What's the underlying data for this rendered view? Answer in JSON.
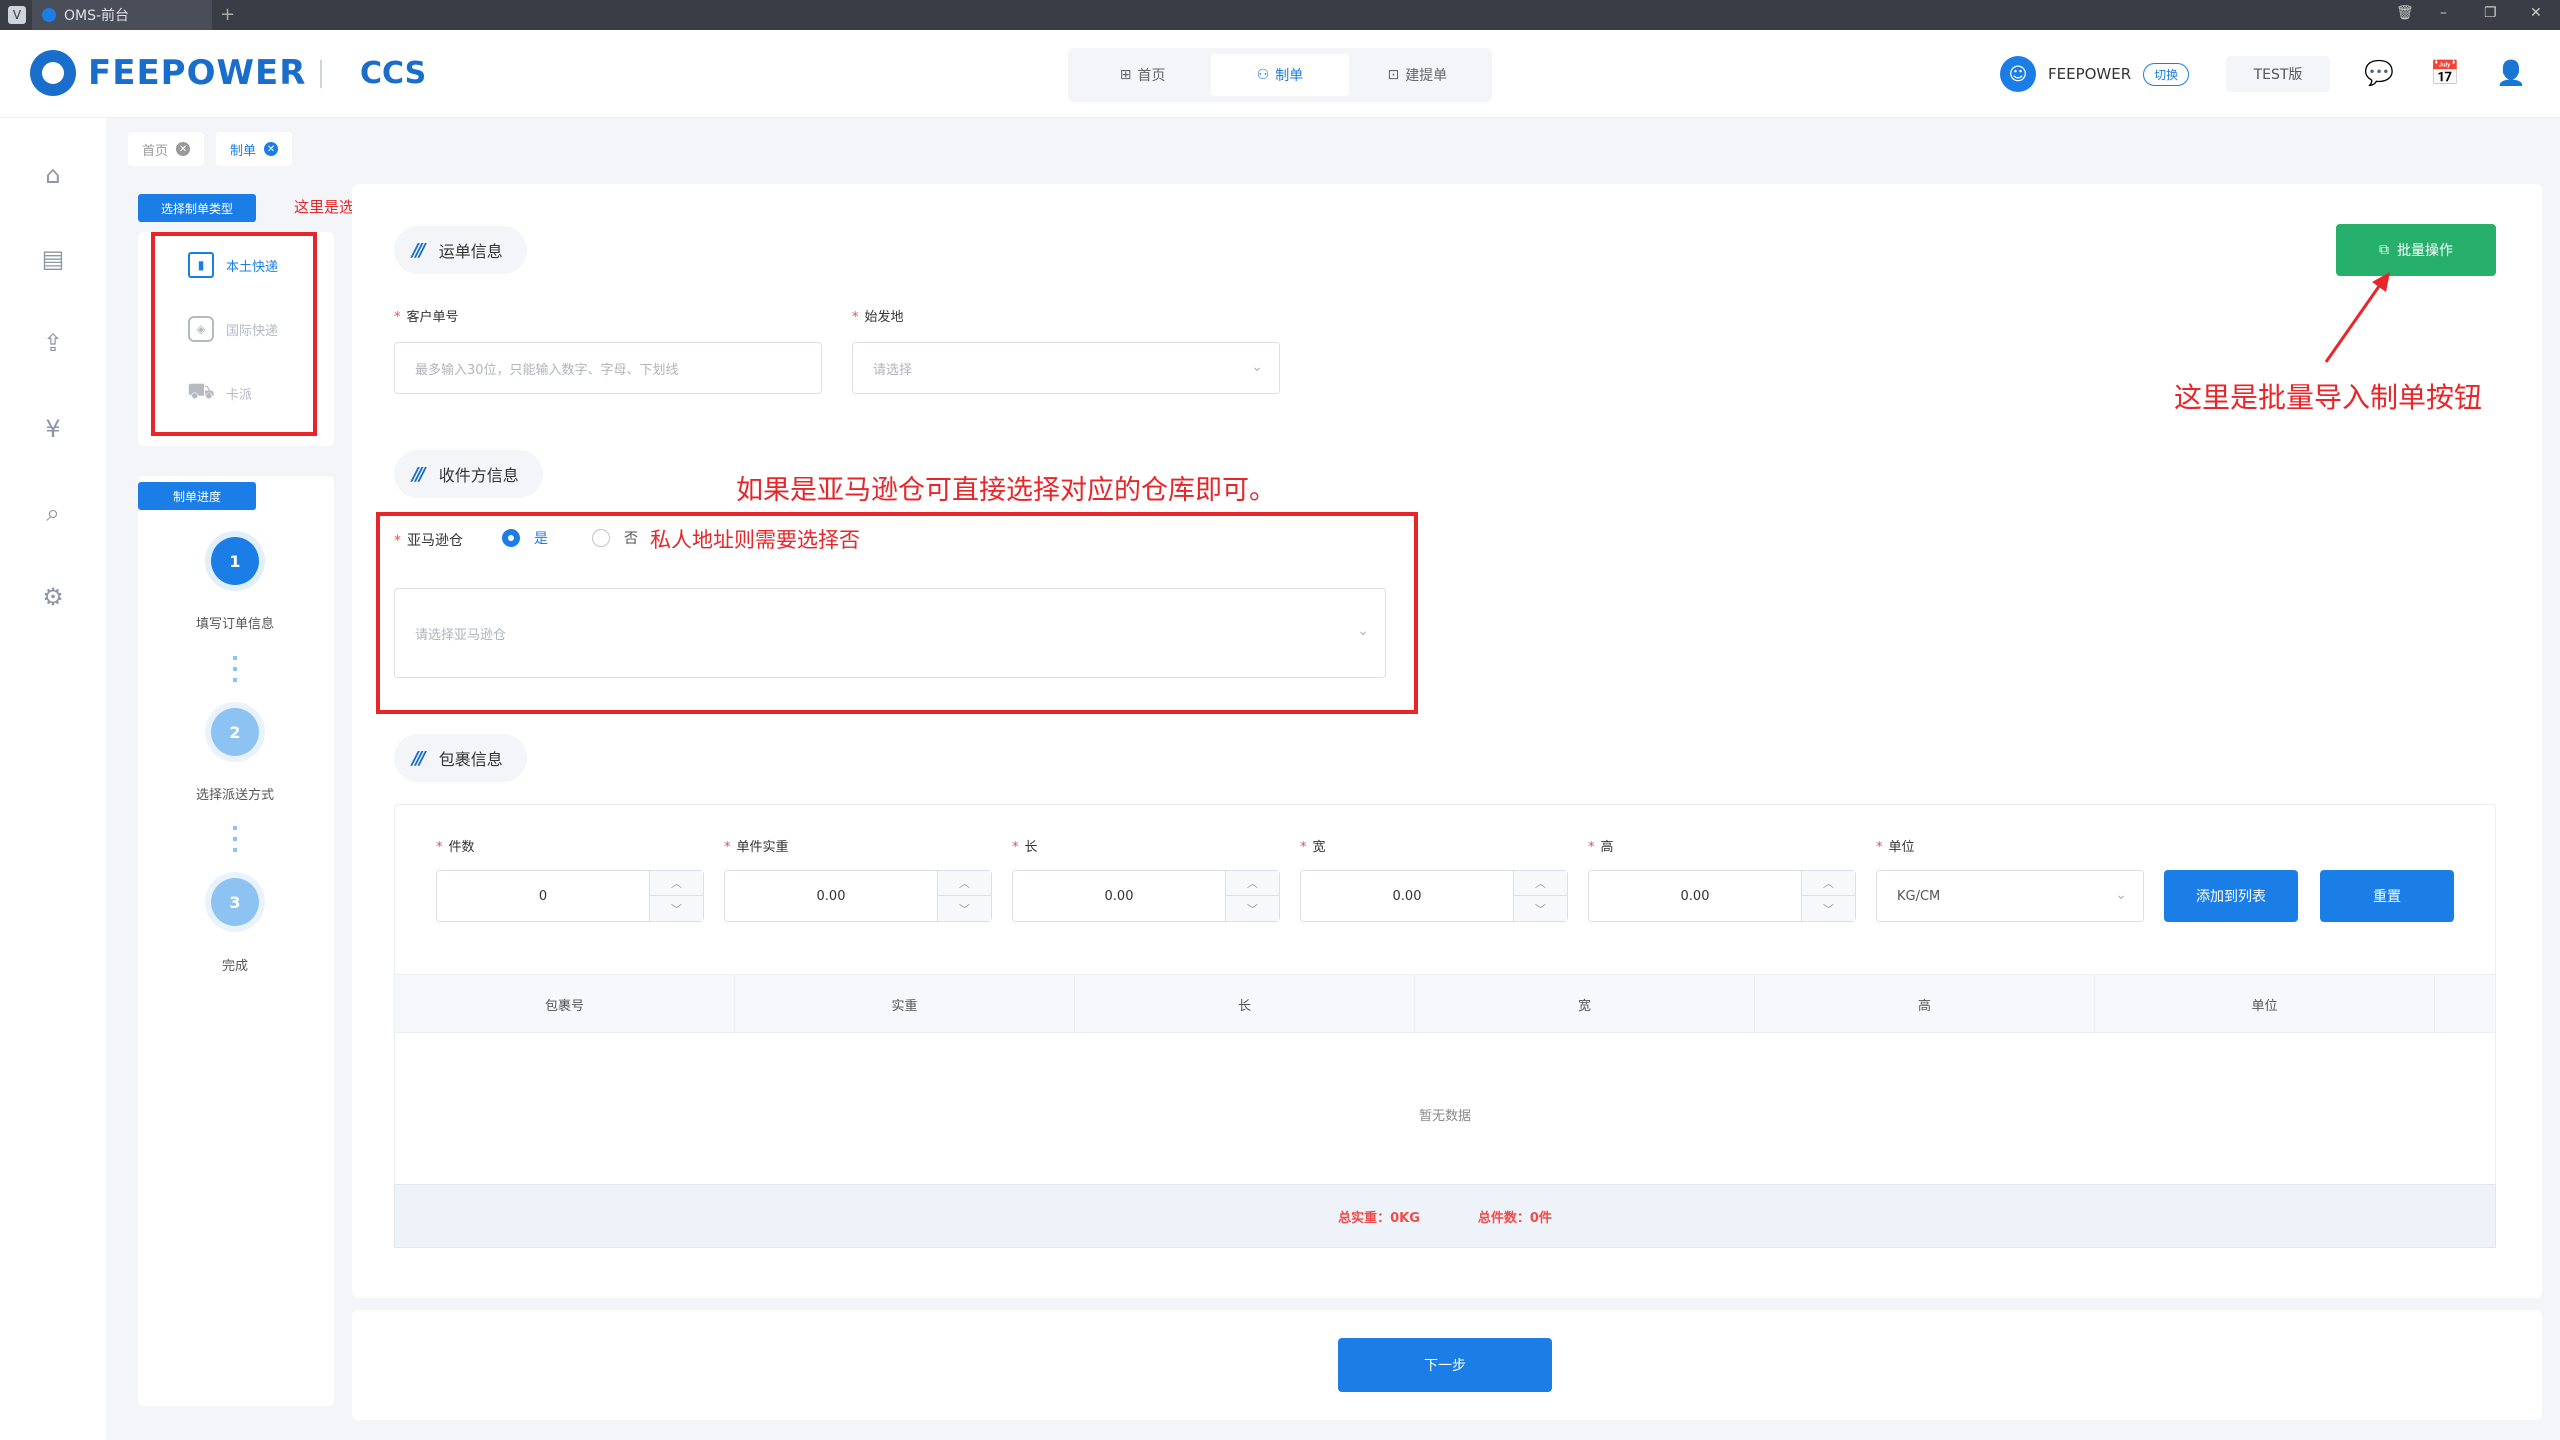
{
  "window": {
    "tab_title": "OMS-前台",
    "new_tab": "+"
  },
  "header": {
    "logo_text": "FEEPOWER",
    "product": "CCS",
    "nav": [
      "首页",
      "制单",
      "建提单"
    ],
    "user_name": "FEEPOWER",
    "switch_label": "切换",
    "edition": "TEST版"
  },
  "breadcrumbs": [
    "首页",
    "制单"
  ],
  "left": {
    "type_chip": "选择制单类型",
    "types": [
      "本土快递",
      "国际快递",
      "卡派"
    ],
    "progress_chip": "制单进度",
    "steps": [
      {
        "num": "1",
        "label": "填写订单信息"
      },
      {
        "num": "2",
        "label": "选择派送方式"
      },
      {
        "num": "3",
        "label": "完成"
      }
    ]
  },
  "waybill": {
    "title": "运单信息",
    "customer_no_label": "客户单号",
    "customer_no_placeholder": "最多输入30位，只能输入数字、字母、下划线",
    "origin_label": "始发地",
    "origin_placeholder": "请选择"
  },
  "batch_button": "批量操作",
  "receiver": {
    "title": "收件方信息",
    "amazon_label": "亚马逊仓",
    "yes": "是",
    "no": "否",
    "warehouse_placeholder": "请选择亚马逊仓"
  },
  "parcel": {
    "title": "包裹信息",
    "fields": [
      {
        "label": "件数",
        "value": "0"
      },
      {
        "label": "单件实重",
        "value": "0.00"
      },
      {
        "label": "长",
        "value": "0.00"
      },
      {
        "label": "宽",
        "value": "0.00"
      },
      {
        "label": "高",
        "value": "0.00"
      }
    ],
    "unit_label": "单位",
    "unit_value": "KG/CM",
    "add_button": "添加到列表",
    "reset_button": "重置",
    "columns": [
      "包裹号",
      "实重",
      "长",
      "宽",
      "高",
      "单位"
    ],
    "empty_text": "暂无数据",
    "total_weight": "总实重：0KG",
    "total_count": "总件数：0件"
  },
  "next_button": "下一步",
  "annotations": {
    "type_note": "这里是选择类型",
    "batch_note": "这里是批量导入制单按钮",
    "amazon_note": "如果是亚马逊仓可直接选择对应的仓库即可。",
    "private_note": "私人地址则需要选择否"
  },
  "colors": {
    "primary": "#1a7ee6",
    "brand": "#1a6ecb",
    "batch_green": "#27b06b",
    "annotation_red": "#e8262a"
  }
}
